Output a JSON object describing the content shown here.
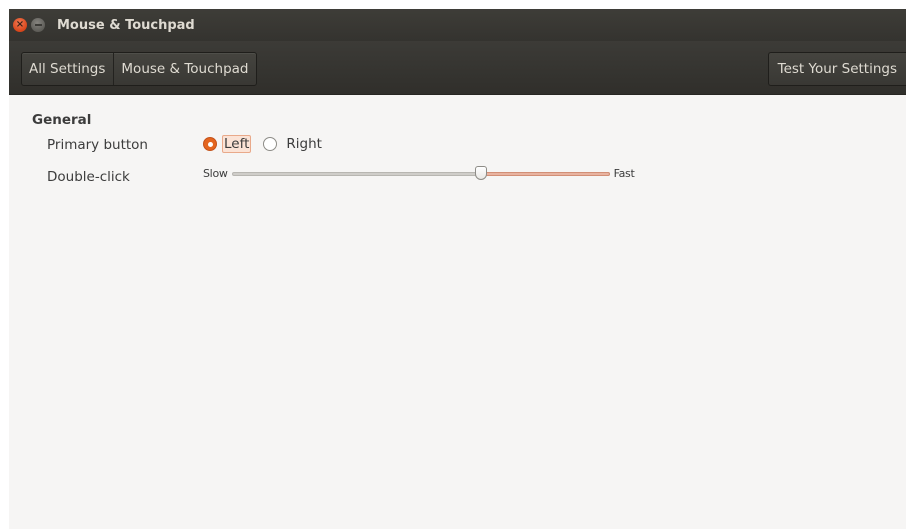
{
  "window": {
    "title": "Mouse & Touchpad",
    "close_glyph": "×"
  },
  "toolbar": {
    "breadcrumbs": [
      "All Settings",
      "Mouse & Touchpad"
    ],
    "test_button_label": "Test Your Settings"
  },
  "general": {
    "section_title": "General",
    "primary_button": {
      "label": "Primary button",
      "options": [
        "Left",
        "Right"
      ],
      "selected": "Left"
    },
    "double_click": {
      "label": "Double-click",
      "min_label": "Slow",
      "max_label": "Fast",
      "value_fraction": 0.66
    }
  },
  "colors": {
    "accent": "#e4651f",
    "toolbar_bg": "#3c3b37",
    "content_bg": "#f6f5f4"
  },
  "icons": {
    "close": "close-icon",
    "minimize": "minimize-icon"
  }
}
